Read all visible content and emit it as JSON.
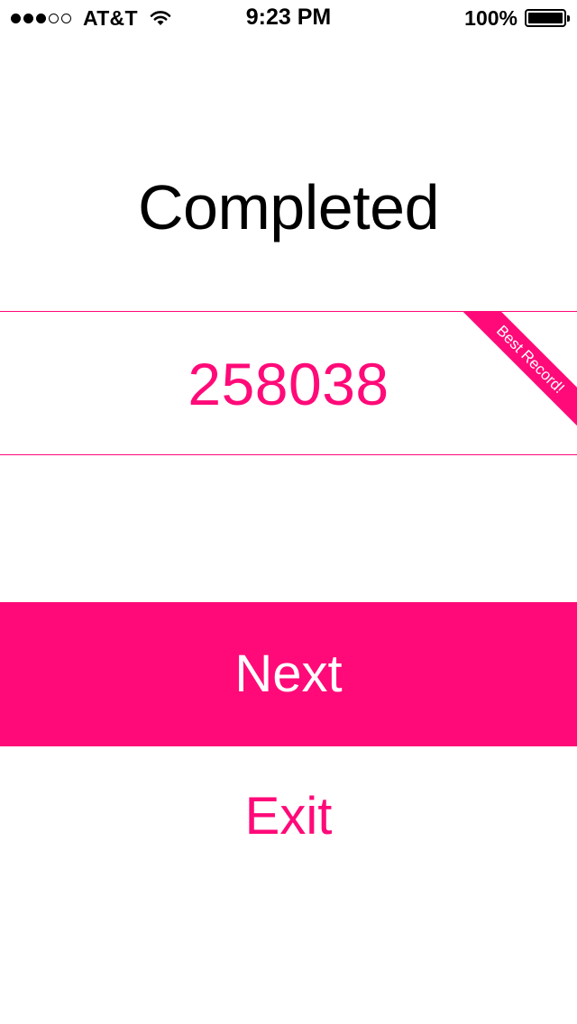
{
  "status_bar": {
    "carrier": "AT&T",
    "time": "9:23 PM",
    "battery": "100%",
    "signal_bars_filled": 3,
    "signal_bars_total": 5
  },
  "screen": {
    "title": "Completed",
    "score": "258038",
    "badge": "Best Record!"
  },
  "actions": {
    "next_label": "Next",
    "exit_label": "Exit"
  },
  "colors": {
    "accent": "#ff0a78",
    "background": "#ffffff",
    "text": "#000000"
  }
}
